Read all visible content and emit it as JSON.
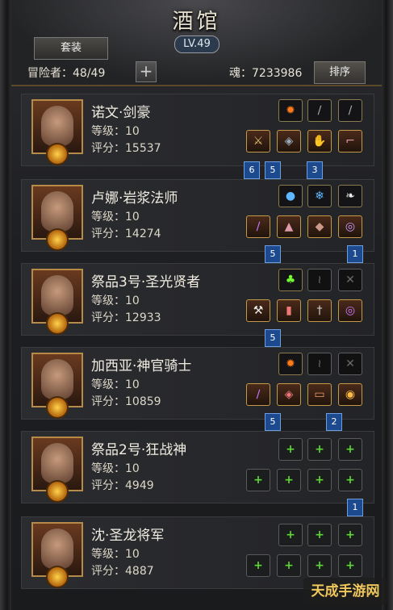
{
  "header": {
    "title": "酒馆",
    "level": "LV.49",
    "suit_button": "套装",
    "adventurer_count": "冒险者：48/49",
    "soul": "魂：7233986",
    "sort_button": "排序"
  },
  "heroes": [
    {
      "name": "诺文·剑豪",
      "level": "等级：10",
      "score": "评分：15537"
    },
    {
      "name": "卢娜·岩浆法师",
      "level": "等级：10",
      "score": "评分：14274"
    },
    {
      "name": "祭品3号·圣光贤者",
      "level": "等级：10",
      "score": "评分：12933"
    },
    {
      "name": "加西亚·神官骑士",
      "level": "等级：10",
      "score": "评分：10859"
    },
    {
      "name": "祭品2号·狂战神",
      "level": "等级：10",
      "score": "评分：4949"
    },
    {
      "name": "沈·圣龙将军",
      "level": "等级：10",
      "score": "评分：4887"
    }
  ],
  "badges": {
    "h1": [
      "6",
      "5",
      "3"
    ],
    "h2": [
      "5",
      "1"
    ],
    "h3": [
      "5"
    ],
    "h4": [
      "5",
      "2"
    ],
    "h5": [
      "1"
    ]
  },
  "watermark": "天成手游网"
}
